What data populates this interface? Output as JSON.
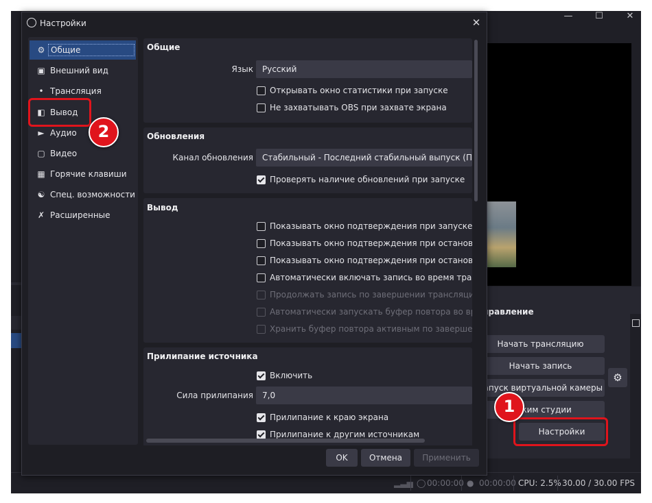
{
  "main_window": {
    "controls": {
      "title": "Управление",
      "start_stream": "Начать трансляцию",
      "start_record": "Начать запись",
      "virtual_camera": "Запуск виртуальной камеры",
      "studio_mode": "Режим студии",
      "settings": "Настройки"
    },
    "statusbar": {
      "stream_time": "00:00:00",
      "record_time": "00:00:00",
      "cpu": "CPU: 2.5%",
      "fps": "30.00 / 30.00 FPS"
    }
  },
  "dialog": {
    "title": "Настройки",
    "sidebar": [
      {
        "label": "Общие",
        "icon": "gear-icon"
      },
      {
        "label": "Внешний вид",
        "icon": "appearance-icon"
      },
      {
        "label": "Трансляция",
        "icon": "broadcast-icon"
      },
      {
        "label": "Вывод",
        "icon": "output-icon"
      },
      {
        "label": "Аудио",
        "icon": "speaker-icon"
      },
      {
        "label": "Видео",
        "icon": "monitor-icon"
      },
      {
        "label": "Горячие клавиши",
        "icon": "keyboard-icon"
      },
      {
        "label": "Спец. возможности",
        "icon": "accessibility-icon"
      },
      {
        "label": "Расширенные",
        "icon": "tools-icon"
      }
    ],
    "general": {
      "title": "Общие",
      "language_label": "Язык",
      "language_value": "Русский",
      "open_stats": "Открывать окно статистики при запуске",
      "no_capture_obs": "Не захватывать OBS при захвате экрана"
    },
    "updates": {
      "title": "Обновления",
      "channel_label": "Канал обновления",
      "channel_value": "Стабильный - Последний стабильный выпуск (По умол",
      "check_updates": "Проверять наличие обновлений при запуске"
    },
    "output": {
      "title": "Вывод",
      "confirm_start": "Показывать окно подтверждения при запуске трансл",
      "confirm_stop": "Показывать окно подтверждения при остановке тран",
      "confirm_stop_rec": "Показывать окно подтверждения при остановке запи",
      "auto_record": "Автоматически включать запись во время трансляци",
      "continue_record": "Продолжать запись по завершении трансляции",
      "auto_replay": "Автоматически запускать буфер повтора во время тр",
      "keep_replay": "Хранить буфер повтора активным по завершении тр"
    },
    "snapping": {
      "title": "Прилипание источника",
      "enable": "Включить",
      "strength_label": "Сила прилипания",
      "strength_value": "7,0",
      "screen_edge": "Прилипание к краю экрана",
      "other_sources": "Прилипание к другим источникам"
    },
    "buttons": {
      "ok": "OK",
      "cancel": "Отмена",
      "apply": "Применить"
    }
  },
  "annotations": {
    "step1": "1",
    "step2": "2",
    "color": "#e0141c"
  }
}
